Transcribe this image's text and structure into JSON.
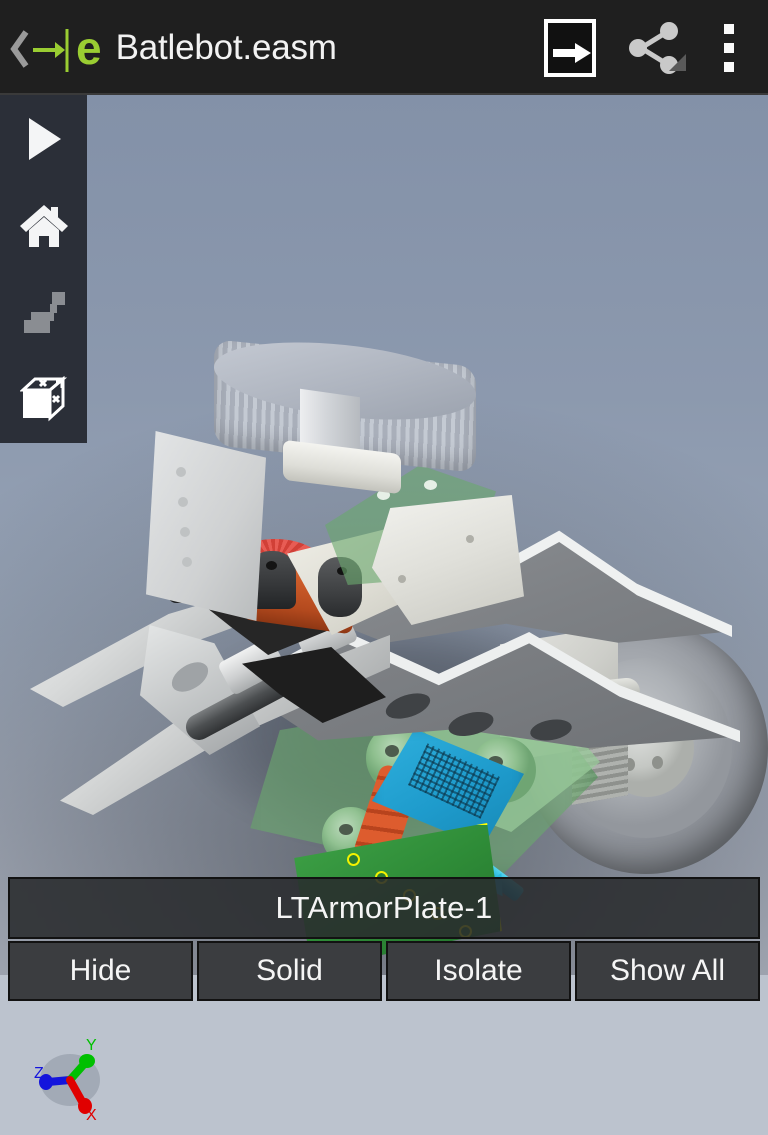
{
  "app": {
    "title": "Batlebot.easm",
    "logo_letter": "e",
    "accent_green": "#9ACD32",
    "appbar_bg": "#1F1F1F"
  },
  "appbar": {
    "back_icon": "chevron-left-icon",
    "logo_icon": "edrawings-arrow-to-bar-icon",
    "actions": [
      {
        "name": "open-in-new-icon",
        "glyph": "exit-arrow-box"
      },
      {
        "name": "share-icon",
        "glyph": "share-nodes"
      },
      {
        "name": "overflow-menu-icon",
        "glyph": "three-dots-vertical"
      }
    ]
  },
  "left_toolbar": {
    "items": [
      {
        "name": "play-animation-button",
        "icon": "play-icon",
        "enabled": true
      },
      {
        "name": "home-view-button",
        "icon": "home-icon",
        "enabled": true
      },
      {
        "name": "explode-steps-button",
        "icon": "explode-steps-icon",
        "enabled": false
      },
      {
        "name": "bounding-box-button",
        "icon": "scale-cube-icon",
        "enabled": true
      }
    ]
  },
  "selection": {
    "component_name": "LTArmorPlate-1",
    "highlight_outline_color": "#FFFF00",
    "highlight_fill_color": "#2E8B37",
    "callout_arrow_color": "#2BBBE0"
  },
  "actions": {
    "buttons": [
      {
        "label": "Hide",
        "name": "hide-button"
      },
      {
        "label": "Solid",
        "name": "solid-button"
      },
      {
        "label": "Isolate",
        "name": "isolate-button"
      },
      {
        "label": "Show All",
        "name": "show-all-button"
      }
    ]
  },
  "triad": {
    "axes": [
      {
        "label": "X",
        "color": "#E00000"
      },
      {
        "label": "Y",
        "color": "#00C000"
      },
      {
        "label": "Z",
        "color": "#0000E0"
      }
    ]
  },
  "viewport": {
    "background_top": "#8391A8",
    "background_bottom": "#B4BAC6"
  }
}
